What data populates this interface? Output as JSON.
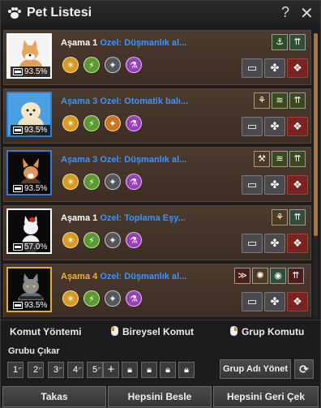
{
  "window": {
    "title": "Pet Listesi",
    "help": "?",
    "close": "✕"
  },
  "pets": [
    {
      "level": "Aşama 1",
      "trait": "Özel: Düşmanlık al...",
      "hunger": "93.5%"
    },
    {
      "level": "Aşama 3",
      "trait": "Özel: Otomatik balı...",
      "hunger": "93.5%"
    },
    {
      "level": "Aşama 3",
      "trait": "Özel: Düşmanlık al...",
      "hunger": "93.5%"
    },
    {
      "level": "Aşama 1",
      "trait": "Özel: Toplama Eşy...",
      "hunger": "57.0%"
    },
    {
      "level": "Aşama 4",
      "trait": "Özel: Düşmanlık al...",
      "hunger": "93.5%"
    }
  ],
  "commands": {
    "method_label": "Komut Yöntemi",
    "individual_label": "Bireysel Komut",
    "group_label": "Grup Komutu"
  },
  "group": {
    "label": "Grubu Çıkar",
    "slots": [
      "1",
      "2",
      "3",
      "4",
      "5"
    ],
    "add": "+",
    "manage_name": "Grup Adı Yönet"
  },
  "footer": {
    "exchange": "Takas",
    "feed_all": "Hepsini Besle",
    "recall_all": "Hepsini Geri Çek"
  }
}
